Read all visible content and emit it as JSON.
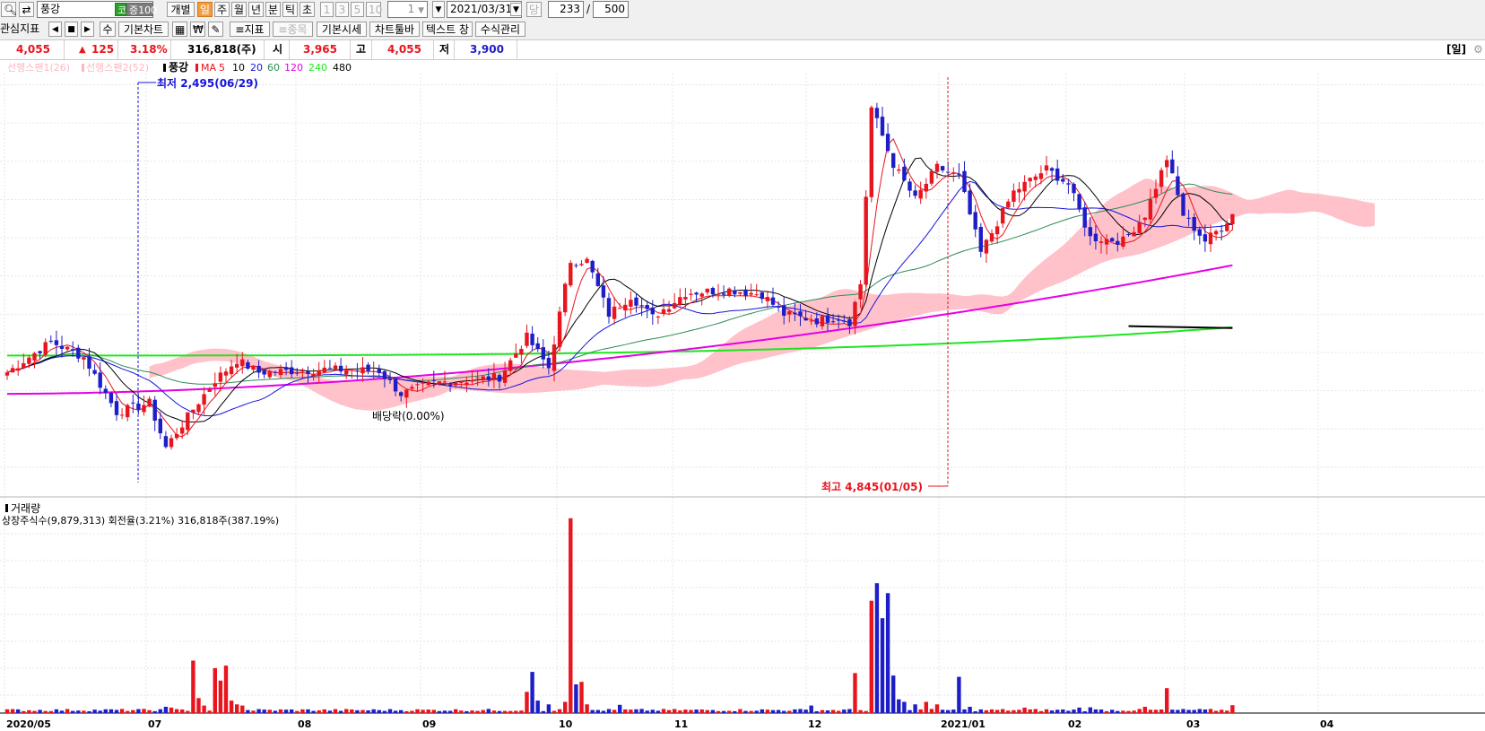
{
  "toolbar": {
    "stock_name": "풍강",
    "market_badge": "코",
    "rank_badge": "증100",
    "btn_individual": "개별",
    "periods": [
      "일",
      "주",
      "월",
      "년",
      "분",
      "틱",
      "초"
    ],
    "selected_period": "일",
    "nums": [
      "1",
      "3",
      "5",
      "10"
    ],
    "step_value": "1",
    "date_value": "2021/03/31",
    "dang_label": "당",
    "count_value": "233",
    "slash": "/",
    "total_value": "500"
  },
  "toolbar2": {
    "watch_indicator": "관심지표",
    "sum_label": "수",
    "basic_chart": "기본차트",
    "indicator_btn": "지표",
    "item_btn": "종목",
    "basic_price": "기본시세",
    "chart_toolbar": "차트툴바",
    "text_window": "텍스트 창",
    "formula_manage": "수식관리"
  },
  "quote": {
    "price": "4,055",
    "change": "125",
    "change_pct": "3.18%",
    "volume": "316,818(주)",
    "open_label": "시",
    "open": "3,965",
    "high_label": "고",
    "high": "4,055",
    "low_label": "저",
    "low": "3,900",
    "period_tag": "[일]"
  },
  "colors": {
    "up": "#e8141e",
    "down": "#1e1ec8",
    "ma5": "#e8141e",
    "ma10": "#000000",
    "ma20": "#1414dc",
    "ma60": "#2e8b57",
    "ma120": "#e600e6",
    "ma240": "#1ee61e",
    "cloud": "#ffb6c1"
  },
  "chart_data": {
    "type": "candlestick",
    "legend": {
      "span1": "선행스팬1(26)",
      "span2": "선행스팬2(52)",
      "name": "풍강",
      "ma_label": "MA",
      "ma_periods": [
        "5",
        "10",
        "20",
        "60",
        "120",
        "240",
        "480"
      ]
    },
    "y_range": [
      2300,
      4950
    ],
    "x_labels": [
      "2020/05",
      "07",
      "08",
      "09",
      "10",
      "11",
      "12",
      "2021/01",
      "02",
      "03",
      "04"
    ],
    "annotations": {
      "low": "최저 2,495(06/29)",
      "high": "최고 4,845(01/05)",
      "dividend": "배당락(0.00%)"
    },
    "ma5_last": 3955,
    "ma10_last": 3985,
    "ma20_last": 3990,
    "ma60_last": 4185,
    "ma120_last": 3720,
    "ma240_last": 3315,
    "ma480_last": 3310,
    "keyframes": [
      {
        "x": 0,
        "c": 3020
      },
      {
        "x": 8,
        "c": 3220
      },
      {
        "x": 14,
        "c": 3120
      },
      {
        "x": 20,
        "c": 2760
      },
      {
        "x": 26,
        "c": 2820
      },
      {
        "x": 29,
        "c": 2530
      },
      {
        "x": 34,
        "c": 2780
      },
      {
        "x": 38,
        "c": 2970
      },
      {
        "x": 42,
        "c": 3100
      },
      {
        "x": 46,
        "c": 3020
      },
      {
        "x": 58,
        "c": 3040
      },
      {
        "x": 68,
        "c": 3030
      },
      {
        "x": 72,
        "c": 2880
      },
      {
        "x": 78,
        "c": 2950
      },
      {
        "x": 90,
        "c": 2990
      },
      {
        "x": 95,
        "c": 3250
      },
      {
        "x": 99,
        "c": 3050
      },
      {
        "x": 103,
        "c": 3750
      },
      {
        "x": 106,
        "c": 3750
      },
      {
        "x": 110,
        "c": 3400
      },
      {
        "x": 114,
        "c": 3520
      },
      {
        "x": 118,
        "c": 3380
      },
      {
        "x": 124,
        "c": 3540
      },
      {
        "x": 132,
        "c": 3560
      },
      {
        "x": 138,
        "c": 3530
      },
      {
        "x": 142,
        "c": 3400
      },
      {
        "x": 148,
        "c": 3360
      },
      {
        "x": 152,
        "c": 3380
      },
      {
        "x": 154,
        "c": 3350
      },
      {
        "x": 156,
        "c": 3600
      },
      {
        "x": 158,
        "c": 4750
      },
      {
        "x": 162,
        "c": 4380
      },
      {
        "x": 166,
        "c": 4150
      },
      {
        "x": 170,
        "c": 4360
      },
      {
        "x": 174,
        "c": 4300
      },
      {
        "x": 178,
        "c": 3800
      },
      {
        "x": 184,
        "c": 4200
      },
      {
        "x": 190,
        "c": 4350
      },
      {
        "x": 194,
        "c": 4250
      },
      {
        "x": 198,
        "c": 3900
      },
      {
        "x": 204,
        "c": 3880
      },
      {
        "x": 208,
        "c": 4050
      },
      {
        "x": 212,
        "c": 4420
      },
      {
        "x": 215,
        "c": 4050
      },
      {
        "x": 219,
        "c": 3880
      },
      {
        "x": 222,
        "c": 3970
      },
      {
        "x": 224,
        "c": 4055
      }
    ],
    "volume": {
      "label": "거래량",
      "info": "상장주식수(9,879,313) 회전율(3.21%) 316,818주(387.19%)",
      "y_max": 7900000,
      "baseline_shares": 120000,
      "spikes": [
        {
          "x": 29,
          "v": 250000
        },
        {
          "x": 30,
          "v": 220000
        },
        {
          "x": 34,
          "v": 2100000
        },
        {
          "x": 35,
          "v": 600000
        },
        {
          "x": 36,
          "v": 300000
        },
        {
          "x": 38,
          "v": 1800000
        },
        {
          "x": 39,
          "v": 1300000
        },
        {
          "x": 40,
          "v": 1900000
        },
        {
          "x": 41,
          "v": 500000
        },
        {
          "x": 42,
          "v": 350000
        },
        {
          "x": 43,
          "v": 300000
        },
        {
          "x": 95,
          "v": 850000
        },
        {
          "x": 96,
          "v": 1650000
        },
        {
          "x": 97,
          "v": 500000
        },
        {
          "x": 99,
          "v": 350000
        },
        {
          "x": 102,
          "v": 450000
        },
        {
          "x": 103,
          "v": 7800000
        },
        {
          "x": 104,
          "v": 1150000
        },
        {
          "x": 105,
          "v": 1250000
        },
        {
          "x": 106,
          "v": 350000
        },
        {
          "x": 112,
          "v": 330000
        },
        {
          "x": 147,
          "v": 300000
        },
        {
          "x": 155,
          "v": 1600000
        },
        {
          "x": 158,
          "v": 4500000
        },
        {
          "x": 159,
          "v": 5200000
        },
        {
          "x": 160,
          "v": 3800000
        },
        {
          "x": 161,
          "v": 4800000
        },
        {
          "x": 162,
          "v": 1500000
        },
        {
          "x": 163,
          "v": 550000
        },
        {
          "x": 164,
          "v": 450000
        },
        {
          "x": 166,
          "v": 350000
        },
        {
          "x": 168,
          "v": 450000
        },
        {
          "x": 170,
          "v": 350000
        },
        {
          "x": 174,
          "v": 1450000
        },
        {
          "x": 176,
          "v": 250000
        },
        {
          "x": 186,
          "v": 220000
        },
        {
          "x": 196,
          "v": 220000
        },
        {
          "x": 198,
          "v": 230000
        },
        {
          "x": 208,
          "v": 250000
        },
        {
          "x": 212,
          "v": 1000000
        },
        {
          "x": 224,
          "v": 316818
        }
      ]
    }
  }
}
